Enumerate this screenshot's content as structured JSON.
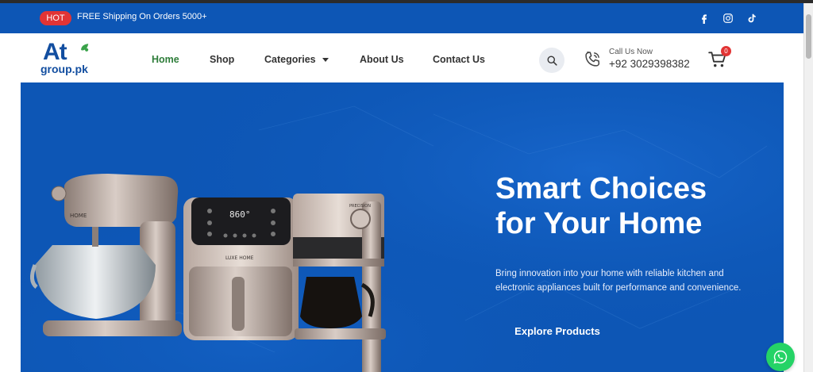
{
  "topbar": {
    "badge": "HOT",
    "shipping_text": "FREE Shipping On Orders 5000+",
    "socials": [
      "facebook-icon",
      "instagram-icon",
      "tiktok-icon"
    ],
    "background": "#0d56b5"
  },
  "header": {
    "logo": {
      "main": "At",
      "sub": "group.pk"
    },
    "nav": [
      {
        "label": "Home",
        "active": true
      },
      {
        "label": "Shop"
      },
      {
        "label": "Categories",
        "has_dropdown": true
      },
      {
        "label": "About Us"
      },
      {
        "label": "Contact Us"
      }
    ],
    "call_label": "Call Us Now",
    "call_number": "+92 3029398382",
    "cart_count": "0"
  },
  "hero": {
    "title_line1": "Smart Choices",
    "title_line2": "for Your Home",
    "description": "Bring innovation into your home with reliable kitchen and electronic appliances built for performance and convenience.",
    "cta": "Explore Products",
    "airfryer_display": "860°",
    "airfryer_brand": "LUXE HOME",
    "coffee_brand": "PRECISION",
    "mixer_brand": "HOME",
    "background": "#0d56b5"
  },
  "colors": {
    "accent_green": "#2e7d3a",
    "badge_red": "#e23434",
    "whatsapp_green": "#25d366"
  }
}
